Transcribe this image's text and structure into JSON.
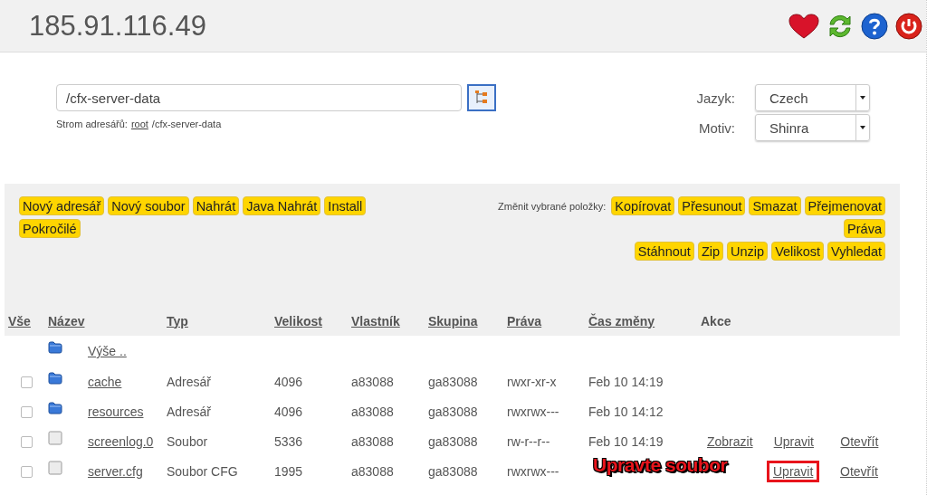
{
  "header": {
    "title": "185.91.116.49"
  },
  "path_field": {
    "value": "/cfx-server-data"
  },
  "breadcrumb": {
    "label": "Strom adresářů:",
    "link": "root",
    "rest": "/cfx-server-data"
  },
  "settings": [
    {
      "label": "Jazyk:",
      "value": "Czech"
    },
    {
      "label": "Motiv:",
      "value": "Shinra"
    }
  ],
  "toolbar": {
    "left_buttons": [
      "Nový adresář",
      "Nový soubor",
      "Nahrát",
      "Java Nahrát",
      "Install",
      "Pokročilé"
    ],
    "selection_label": "Změnit vybrané položky:",
    "right_rows": [
      [
        "Kopírovat",
        "Přesunout",
        "Smazat",
        "Přejmenovat"
      ],
      [
        "Práva"
      ],
      [
        "Stáhnout",
        "Zip",
        "Unzip",
        "Velikost",
        "Vyhledat"
      ]
    ]
  },
  "table": {
    "columns": [
      "Vše",
      "Název",
      "Typ",
      "Velikost",
      "Vlastník",
      "Skupina",
      "Práva",
      "Čas změny",
      "Akce"
    ],
    "rows": [
      {
        "kind": "parent",
        "name": "Výše .."
      },
      {
        "kind": "folder",
        "checked": false,
        "name": "cache",
        "type": "Adresář",
        "size": "4096",
        "owner": "a83088",
        "group": "ga83088",
        "perms": "rwxr-xr-x",
        "time": "Feb 10 14:19",
        "actions": []
      },
      {
        "kind": "folder",
        "checked": false,
        "name": "resources",
        "type": "Adresář",
        "size": "4096",
        "owner": "a83088",
        "group": "ga83088",
        "perms": "rwxrwx---",
        "time": "Feb 10 14:12",
        "actions": []
      },
      {
        "kind": "file",
        "checked": false,
        "name": "screenlog.0",
        "type": "Soubor",
        "size": "5336",
        "owner": "a83088",
        "group": "ga83088",
        "perms": "rw-r--r--",
        "time": "Feb 10 14:19",
        "actions": [
          {
            "label": "Zobrazit",
            "highlighted": false
          },
          {
            "label": "Upravit",
            "highlighted": false
          },
          {
            "label": "Otevřít",
            "highlighted": false
          }
        ]
      },
      {
        "kind": "file",
        "checked": false,
        "name": "server.cfg",
        "type": "Soubor CFG",
        "size": "1995",
        "owner": "a83088",
        "group": "ga83088",
        "perms": "rwxrwx---",
        "actions": [
          {
            "label": "Upravit",
            "highlighted": true
          },
          {
            "label": "Otevřít",
            "highlighted": false
          }
        ]
      }
    ]
  },
  "annotation": {
    "text": "Upravte soubor"
  }
}
